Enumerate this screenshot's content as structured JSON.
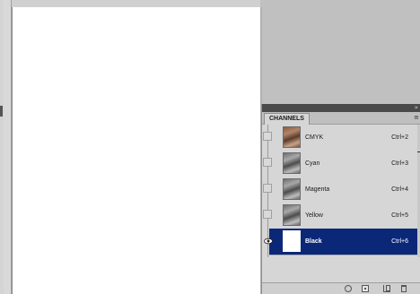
{
  "panel": {
    "tab_label": "CHANNELS",
    "collapse_symbol": "»",
    "menu_symbol": "≡"
  },
  "channels": [
    {
      "name": "CMYK",
      "shortcut": "Ctrl+2",
      "thumb": "color",
      "visible": false,
      "selected": false
    },
    {
      "name": "Cyan",
      "shortcut": "Ctrl+3",
      "thumb": "gray",
      "visible": false,
      "selected": false
    },
    {
      "name": "Magenta",
      "shortcut": "Ctrl+4",
      "thumb": "gray",
      "visible": false,
      "selected": false
    },
    {
      "name": "Yellow",
      "shortcut": "Ctrl+5",
      "thumb": "gray",
      "visible": false,
      "selected": false
    },
    {
      "name": "Black",
      "shortcut": "Ctrl+6",
      "thumb": "white",
      "visible": true,
      "selected": true
    }
  ],
  "footer_icons": [
    "load-selection-icon",
    "save-selection-icon",
    "new-channel-icon",
    "delete-channel-icon"
  ],
  "colors": {
    "selection": "#0b2878",
    "canvas": "#ffffff",
    "workspace": "#c0c0c0"
  }
}
